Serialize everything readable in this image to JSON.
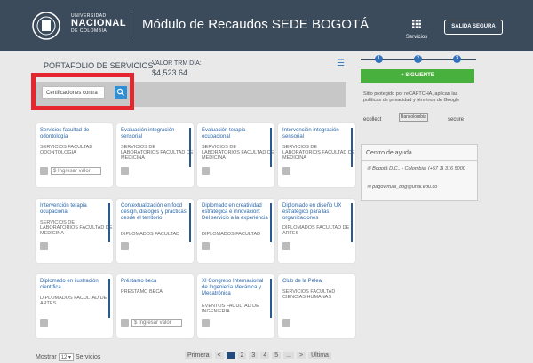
{
  "header": {
    "university_small1": "UNIVERSIDAD",
    "university_big": "NACIONAL",
    "university_small2": "DE COLOMBIA",
    "title": "Módulo de Recaudos SEDE BOGOTÁ",
    "services_label": "Servicios",
    "exit_label": "SALIDA SEGURA"
  },
  "portfolio": {
    "title": "PORTAFOLIO DE SERVICIOS",
    "trm_label": "VALOR TRM DÍA:",
    "trm_value": "$4,523.64",
    "search_value": "Certificaciones contra"
  },
  "cards": [
    {
      "title": "Servicios facultad de odontología",
      "subtitle": "SERVICIOS FACULTAD ODONTOLOGIA",
      "price_placeholder": "$ Ingresar valor"
    },
    {
      "title": "Evaluación integración sensorial",
      "subtitle": "SERVICIOS DE LABORATORIOS FACULTAD DE MEDICINA"
    },
    {
      "title": "Evaluación terapia ocupacional",
      "subtitle": "SERVICIOS DE LABORATORIOS FACULTAD DE MEDICINA"
    },
    {
      "title": "Intervención integración sensorial",
      "subtitle": "SERVICIOS DE LABORATORIOS FACULTAD DE MEDICINA"
    },
    {
      "title": "Intervención terapia ocupacional",
      "subtitle": "SERVICIOS DE LABORATORIOS FACULTAD DE MEDICINA"
    },
    {
      "title": "Contextualización en food design, diálogos y prácticas desde el territorio",
      "subtitle": "DIPLOMADOS FACULTAD"
    },
    {
      "title": "Diplomado en creatividad estratégica e innovación: Del servicio a la experiencia",
      "subtitle": "DIPLOMADOS FACULTAD"
    },
    {
      "title": "Diplomado en diseño UX estratégico para las organizaciones",
      "subtitle": "DIPLOMADOS FACULTAD DE ARTES"
    },
    {
      "title": "Diplomado en ilustración científica",
      "subtitle": "DIPLOMADOS FACULTAD DE ARTES"
    },
    {
      "title": "Préstamo beca",
      "subtitle": "PRESTAMO BECA",
      "price_placeholder": "$ Ingresar valor"
    },
    {
      "title": "XI Congreso Internacional de Ingeniería Mecánica y Mecatrónica",
      "subtitle": "EVENTOS FACULTAD DE INGENIERIA"
    },
    {
      "title": "Club de la Pelea",
      "subtitle": "SERVICIOS FACULTAD CIENCIAS HUMANAS"
    }
  ],
  "steps": [
    "1",
    "2",
    "3"
  ],
  "next_button": "+ SIGUIENTE",
  "captcha_text": "Sitio protegido por reCAPTCHA, aplican las políticas de privacidad y términos de Google",
  "payment_logos": [
    "ecollect",
    "Bancolombia",
    "secure"
  ],
  "help": {
    "title": "Centro de ayuda",
    "phone": "Bogotá D.C., - Colombia: (+57 1) 316 5000",
    "email": "pagovirtual_bog@unal.edu.co"
  },
  "footer": {
    "show_label": "Mostrar",
    "show_value": "12",
    "services_label": "Servicios",
    "pager": [
      "Primera",
      "<",
      "1",
      "2",
      "3",
      "4",
      "5",
      "...",
      ">",
      "Última"
    ]
  },
  "colors": {
    "header": "#3b4b5c",
    "accent": "#2f8ed4",
    "next": "#48b03c",
    "highlight": "#e6262e"
  }
}
